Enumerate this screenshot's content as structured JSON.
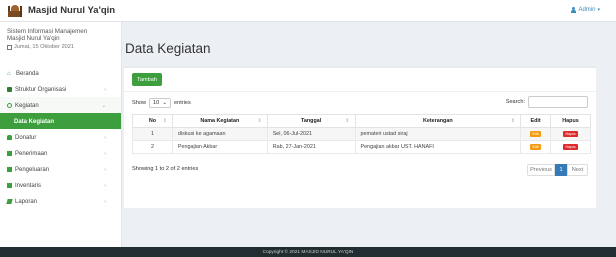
{
  "app": {
    "brand": "Masjid Nurul Ya'qin",
    "admin_label": "Admin"
  },
  "sidebar": {
    "system_line1": "Sistem Informasi Manajemen",
    "system_line2": "Masjid Nurul Ya'qin",
    "date": "Jumat, 15 Oktober 2021",
    "items": [
      {
        "label": "Beranda",
        "icon": "home-icon"
      },
      {
        "label": "Struktur Organisasi",
        "icon": "sitemap-icon"
      },
      {
        "label": "Kegiatan",
        "icon": "gear-icon"
      },
      {
        "label": "Data Kegiatan",
        "icon": ""
      },
      {
        "label": "Donatur",
        "icon": "users-icon"
      },
      {
        "label": "Penerimaan",
        "icon": "folder-icon"
      },
      {
        "label": "Pengeluaran",
        "icon": "folder-open-icon"
      },
      {
        "label": "Inventaris",
        "icon": "inventory-icon"
      },
      {
        "label": "Laporan",
        "icon": "book-icon"
      }
    ]
  },
  "main": {
    "title": "Data Kegiatan",
    "add_label": "Tambah",
    "show_label": "Show",
    "entries_value": "10",
    "entries_label": "entries",
    "search_label": "Search:",
    "columns": [
      "No",
      "Nama Kegiatan",
      "Tanggal",
      "Keterangan",
      "Edit",
      "Hapus"
    ],
    "rows": [
      {
        "no": "1",
        "nama": "diskusi ke agamaan",
        "tanggal": "Sel, 06-Jul-2021",
        "keterangan": "pemateri ustad siraj"
      },
      {
        "no": "2",
        "nama": "Pengajian Akbar",
        "tanggal": "Rab, 27-Jan-2021",
        "keterangan": "Pengajian akbar UST. HANAFI"
      }
    ],
    "edit_label": "Edit",
    "delete_label": "Hapus",
    "info": "Showing 1 to 2 of 2 entries",
    "pager": {
      "prev": "Previous",
      "current": "1",
      "next": "Next"
    }
  },
  "footer": "Copyright © 2021 MASJID NURUL YA'QIN",
  "colors": {
    "accent_green": "#3c9e3c",
    "edit_orange": "#f39c12",
    "delete_red": "#dd2c2c",
    "pager_blue": "#337ab7"
  }
}
